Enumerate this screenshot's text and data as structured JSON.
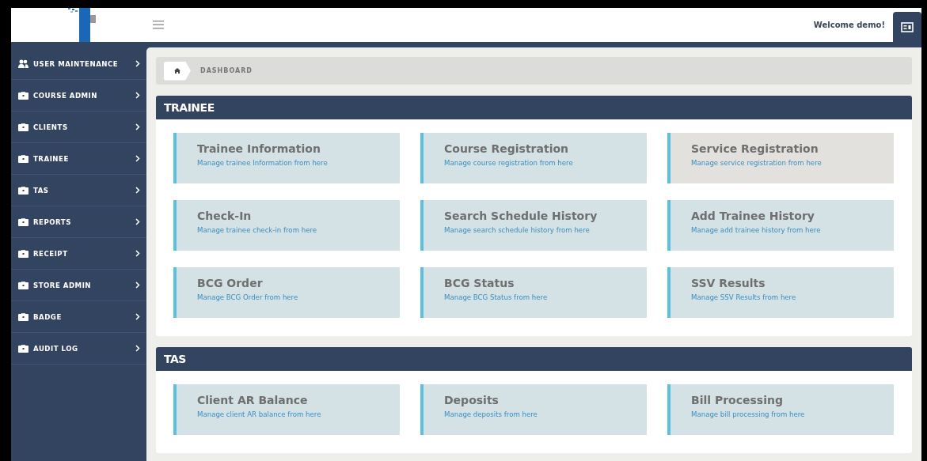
{
  "header": {
    "welcome": "Welcome demo!"
  },
  "sidebar": {
    "items": [
      {
        "label": "USER MAINTENANCE",
        "kind": "users"
      },
      {
        "label": "COURSE ADMIN",
        "kind": "briefcase"
      },
      {
        "label": "CLIENTS",
        "kind": "briefcase"
      },
      {
        "label": "TRAINEE",
        "kind": "briefcase"
      },
      {
        "label": "TAS",
        "kind": "briefcase"
      },
      {
        "label": "REPORTS",
        "kind": "briefcase"
      },
      {
        "label": "RECEIPT",
        "kind": "briefcase"
      },
      {
        "label": "STORE ADMIN",
        "kind": "briefcase"
      },
      {
        "label": "BADGE",
        "kind": "briefcase"
      },
      {
        "label": "AUDIT LOG",
        "kind": "briefcase"
      }
    ]
  },
  "breadcrumb": {
    "current": "DASHBOARD"
  },
  "panels": [
    {
      "title": "TRAINEE",
      "cards": [
        {
          "title": "Trainee Information",
          "subtitle": "Manage trainee Information from here",
          "hovered": false
        },
        {
          "title": "Course Registration",
          "subtitle": "Manage course registration from here",
          "hovered": false
        },
        {
          "title": "Service Registration",
          "subtitle": "Manage service registration from here",
          "hovered": true
        },
        {
          "title": "Check-In",
          "subtitle": "Manage trainee check-in from here",
          "hovered": false
        },
        {
          "title": "Search Schedule History",
          "subtitle": "Manage search schedule history from here",
          "hovered": false
        },
        {
          "title": "Add Trainee History",
          "subtitle": "Manage add trainee history from here",
          "hovered": false
        },
        {
          "title": "BCG Order",
          "subtitle": "Manage BCG Order from here",
          "hovered": false
        },
        {
          "title": "BCG Status",
          "subtitle": "Manage BCG Status from here",
          "hovered": false
        },
        {
          "title": "SSV Results",
          "subtitle": "Manage SSV Results from here",
          "hovered": false
        }
      ]
    },
    {
      "title": "TAS",
      "cards": [
        {
          "title": "Client AR Balance",
          "subtitle": "Manage client AR balance from here",
          "hovered": false
        },
        {
          "title": "Deposits",
          "subtitle": "Manage deposits from here",
          "hovered": false
        },
        {
          "title": "Bill Processing",
          "subtitle": "Manage bill processing from here",
          "hovered": false
        }
      ]
    }
  ]
}
